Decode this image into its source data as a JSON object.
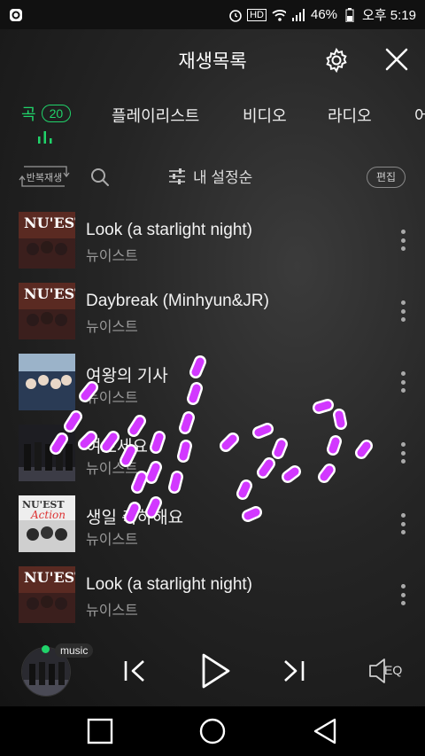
{
  "status_bar": {
    "hd": "HD",
    "battery": "46%",
    "time": "오후 5:19"
  },
  "header": {
    "title": "재생목록"
  },
  "tabs": [
    {
      "label": "곡",
      "count": "20",
      "active": true
    },
    {
      "label": "플레이리스트"
    },
    {
      "label": "비디오"
    },
    {
      "label": "라디오"
    },
    {
      "label": "어"
    }
  ],
  "toolbar": {
    "repeat_label": "반복재생",
    "sort_label": "내 설정순",
    "edit_label": "편집"
  },
  "songs": [
    {
      "title": "Look (a starlight night)",
      "artist": "뉴이스트",
      "cover": "nuest-look"
    },
    {
      "title": "Daybreak (Minhyun&JR)",
      "artist": "뉴이스트",
      "cover": "nuest-look"
    },
    {
      "title": "여왕의 기사",
      "artist": "뉴이스트",
      "cover": "queens-knight"
    },
    {
      "title": "여보세요",
      "artist": "뉴이스트",
      "cover": "hello"
    },
    {
      "title": "생일 축하해요",
      "artist": "뉴이스트",
      "cover": "action"
    },
    {
      "title": "Look (a starlight night)",
      "artist": "뉴이스트",
      "cover": "nuest-look"
    }
  ],
  "player": {
    "tag": "music",
    "eq_label": "EQ"
  },
  "colors": {
    "accent": "#20d36a",
    "scribble": "#d238ff"
  }
}
